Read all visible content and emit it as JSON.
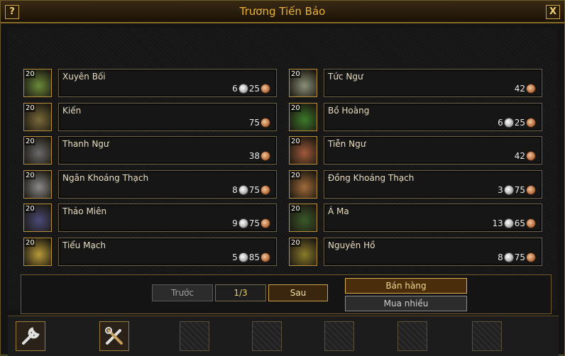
{
  "window": {
    "title": "Trương Tiến Bảo",
    "help_label": "?",
    "close_label": "X"
  },
  "items": [
    {
      "qty": "20",
      "name": "Xuyên Bối",
      "silver": "6",
      "copper": "25",
      "icon": "herb-icon",
      "color": "#6a8a3a"
    },
    {
      "qty": "20",
      "name": "Tức Ngư",
      "silver": "",
      "copper": "42",
      "icon": "fish-icon",
      "color": "#8a9078"
    },
    {
      "qty": "20",
      "name": "Kiến",
      "silver": "",
      "copper": "75",
      "icon": "ant-icon",
      "color": "#7a6a3a"
    },
    {
      "qty": "20",
      "name": "Bồ Hoàng",
      "silver": "6",
      "copper": "25",
      "icon": "leaf-icon",
      "color": "#3a7a2a"
    },
    {
      "qty": "20",
      "name": "Thanh Ngư",
      "silver": "",
      "copper": "38",
      "icon": "fish-icon",
      "color": "#6a6a6a"
    },
    {
      "qty": "20",
      "name": "Tiễn Ngư",
      "silver": "",
      "copper": "42",
      "icon": "fish-icon",
      "color": "#a05a3a"
    },
    {
      "qty": "20",
      "name": "Ngân Khoáng Thạch",
      "silver": "8",
      "copper": "75",
      "icon": "ore-icon",
      "color": "#8a8a8a"
    },
    {
      "qty": "20",
      "name": "Đồng Khoáng Thạch",
      "silver": "3",
      "copper": "75",
      "icon": "ore-icon",
      "color": "#a06a3a"
    },
    {
      "qty": "20",
      "name": "Thảo Miên",
      "silver": "9",
      "copper": "75",
      "icon": "cotton-icon",
      "color": "#4a4a7a"
    },
    {
      "qty": "20",
      "name": "Á Ma",
      "silver": "13",
      "copper": "65",
      "icon": "plant-icon",
      "color": "#3a5a2a"
    },
    {
      "qty": "20",
      "name": "Tiểu Mạch",
      "silver": "5",
      "copper": "85",
      "icon": "wheat-icon",
      "color": "#b89a3a"
    },
    {
      "qty": "20",
      "name": "Nguyên Hồ",
      "silver": "8",
      "copper": "75",
      "icon": "root-icon",
      "color": "#8a7a2a"
    }
  ],
  "pagination": {
    "prev_label": "Trước",
    "page_label": "1/3",
    "next_label": "Sau"
  },
  "actions": {
    "sell_label": "Bán hàng",
    "buy_many_label": "Mua nhiều"
  },
  "toolbar": [
    {
      "icon": "wrench-icon"
    },
    {
      "icon": "tools-icon"
    },
    {
      "icon": "empty-slot-icon"
    },
    {
      "icon": "empty-slot-icon"
    },
    {
      "icon": "empty-slot-icon"
    },
    {
      "icon": "empty-slot-icon"
    },
    {
      "icon": "empty-slot-icon"
    }
  ]
}
